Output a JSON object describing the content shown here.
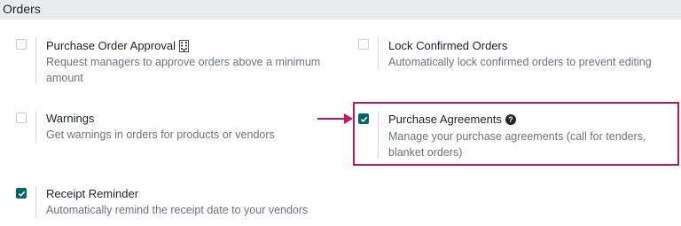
{
  "section": {
    "title": "Orders"
  },
  "settings": {
    "purchase_order_approval": {
      "title": "Purchase Order Approval",
      "description": "Request managers to approve orders above a minimum amount",
      "checked": false
    },
    "lock_confirmed_orders": {
      "title": "Lock Confirmed Orders",
      "description": "Automatically lock confirmed orders to prevent editing",
      "checked": false
    },
    "warnings": {
      "title": "Warnings",
      "description": "Get warnings in orders for products or vendors",
      "checked": false
    },
    "purchase_agreements": {
      "title": "Purchase Agreements",
      "description": "Manage your purchase agreements (call for tenders, blanket orders)",
      "checked": true
    },
    "receipt_reminder": {
      "title": "Receipt Reminder",
      "description": "Automatically remind the receipt date to your vendors",
      "checked": true
    }
  },
  "icons": {
    "company_setting": "building-icon",
    "help": "question-circle-icon",
    "annotation_arrow": "arrow-right-icon",
    "checkmark": "check-icon"
  },
  "colors": {
    "checkbox_checked": "#01666b",
    "highlight": "#c2185b",
    "header_bg": "#e9ecef"
  }
}
